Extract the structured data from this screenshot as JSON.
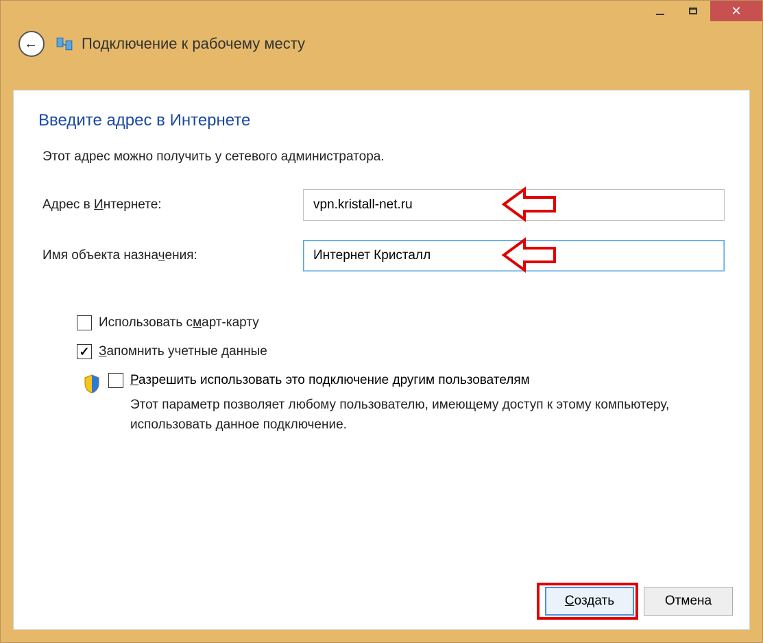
{
  "wizard_title": "Подключение к рабочему месту",
  "page_heading": "Введите адрес в Интернете",
  "description": "Этот адрес можно получить у сетевого администратора.",
  "fields": {
    "internet_address": {
      "label_before": "Адрес в ",
      "label_underlined": "И",
      "label_after": "нтернете:",
      "value": "vpn.kristall-net.ru"
    },
    "destination_name": {
      "label_before": "Имя объекта назна",
      "label_underlined": "ч",
      "label_after": "ения:",
      "value": "Интернет Кристалл"
    }
  },
  "checkboxes": {
    "smartcard": {
      "label_before": "Использовать с",
      "label_underlined": "м",
      "label_after": "арт-карту",
      "checked": false
    },
    "remember": {
      "label_before": "",
      "label_underlined": "З",
      "label_after": "апомнить учетные данные",
      "checked": true
    },
    "share": {
      "label_before": "",
      "label_underlined": "Р",
      "label_after": "азрешить использовать это подключение другим пользователям",
      "hint": "Этот параметр позволяет любому пользователю, имеющему доступ к этому компьютеру, использовать данное подключение.",
      "checked": false
    }
  },
  "buttons": {
    "create_before": "",
    "create_underlined": "С",
    "create_after": "оздать",
    "cancel": "Отмена"
  }
}
